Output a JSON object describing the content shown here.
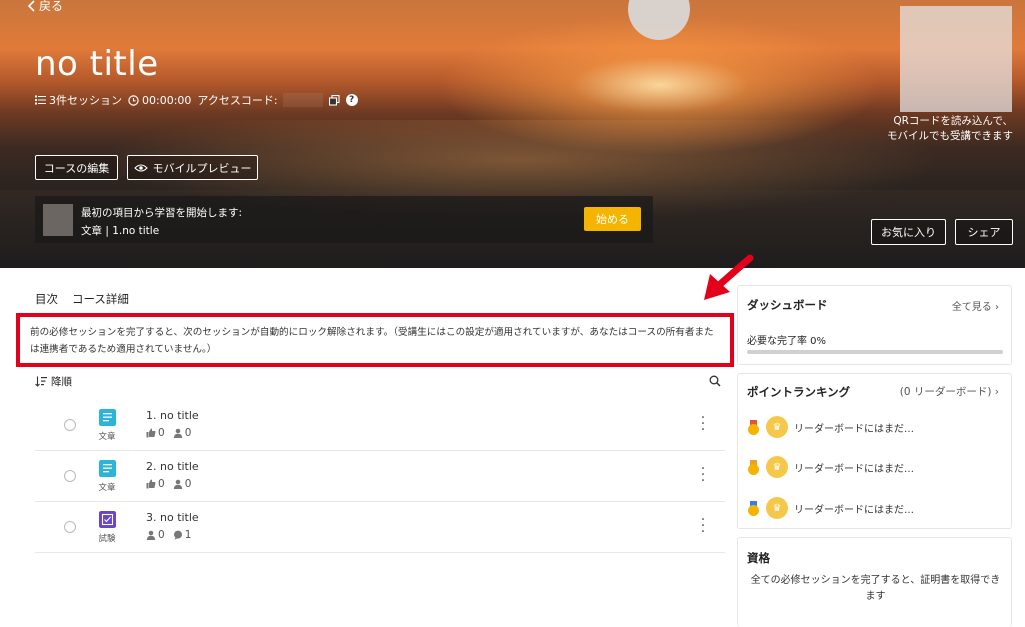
{
  "nav": {
    "back_label": "戻る"
  },
  "course": {
    "title": "no title",
    "session_count": "3件セッション",
    "duration": "00:00:00",
    "access_code_label": "アクセスコード:",
    "help_glyph": "?"
  },
  "qr": {
    "caption_line1": "QRコードを読み込んで、",
    "caption_line2": "モバイルでも受講できます"
  },
  "actions": {
    "edit_course": "コースの編集",
    "mobile_preview": "モバイルプレビュー",
    "favorite": "お気に入り",
    "share": "シェア"
  },
  "start_panel": {
    "heading": "最初の項目から学習を開始します:",
    "item": "文章 | 1.no title",
    "start_button": "始める"
  },
  "tabs": [
    {
      "label": "目次"
    },
    {
      "label": "コース詳細"
    }
  ],
  "notice": {
    "text": "前の必修セッションを完了すると、次のセッションが自動的にロック解除されます。（受講生にはこの設定が適用されていますが、あなたはコースの所有者または連携者であるため適用されていません。）"
  },
  "list": {
    "sort_label": "降順",
    "items": [
      {
        "number_title": "1. no title",
        "type_label": "文章",
        "type_color": "#2bb5d6",
        "likes": "0",
        "users": "0"
      },
      {
        "number_title": "2. no title",
        "type_label": "文章",
        "type_color": "#2bb5d6",
        "likes": "0",
        "users": "0"
      },
      {
        "number_title": "3. no title",
        "type_label": "試験",
        "type_color": "#6b45c7",
        "users": "0",
        "comments": "1"
      }
    ]
  },
  "dashboard": {
    "title": "ダッシュボード",
    "see_all": "全て見る",
    "completion": "必要な完了率 0%",
    "completion_value": 0
  },
  "ranking": {
    "title": "ポイントランキング",
    "count": "(0 リーダーボード)",
    "entries": [
      {
        "text": "リーダーボードにはまだ…",
        "ribbon_color": "#e2543b"
      },
      {
        "text": "リーダーボードにはまだ…",
        "ribbon_color": "#f0a020"
      },
      {
        "text": "リーダーボードにはまだ…",
        "ribbon_color": "#3b7be2"
      }
    ]
  },
  "certificate": {
    "title": "資格",
    "text": "全ての必修セッションを完了すると、証明書を取得できます"
  },
  "colors": {
    "accent_yellow": "#f5b400",
    "highlight_red": "#e3001b"
  }
}
